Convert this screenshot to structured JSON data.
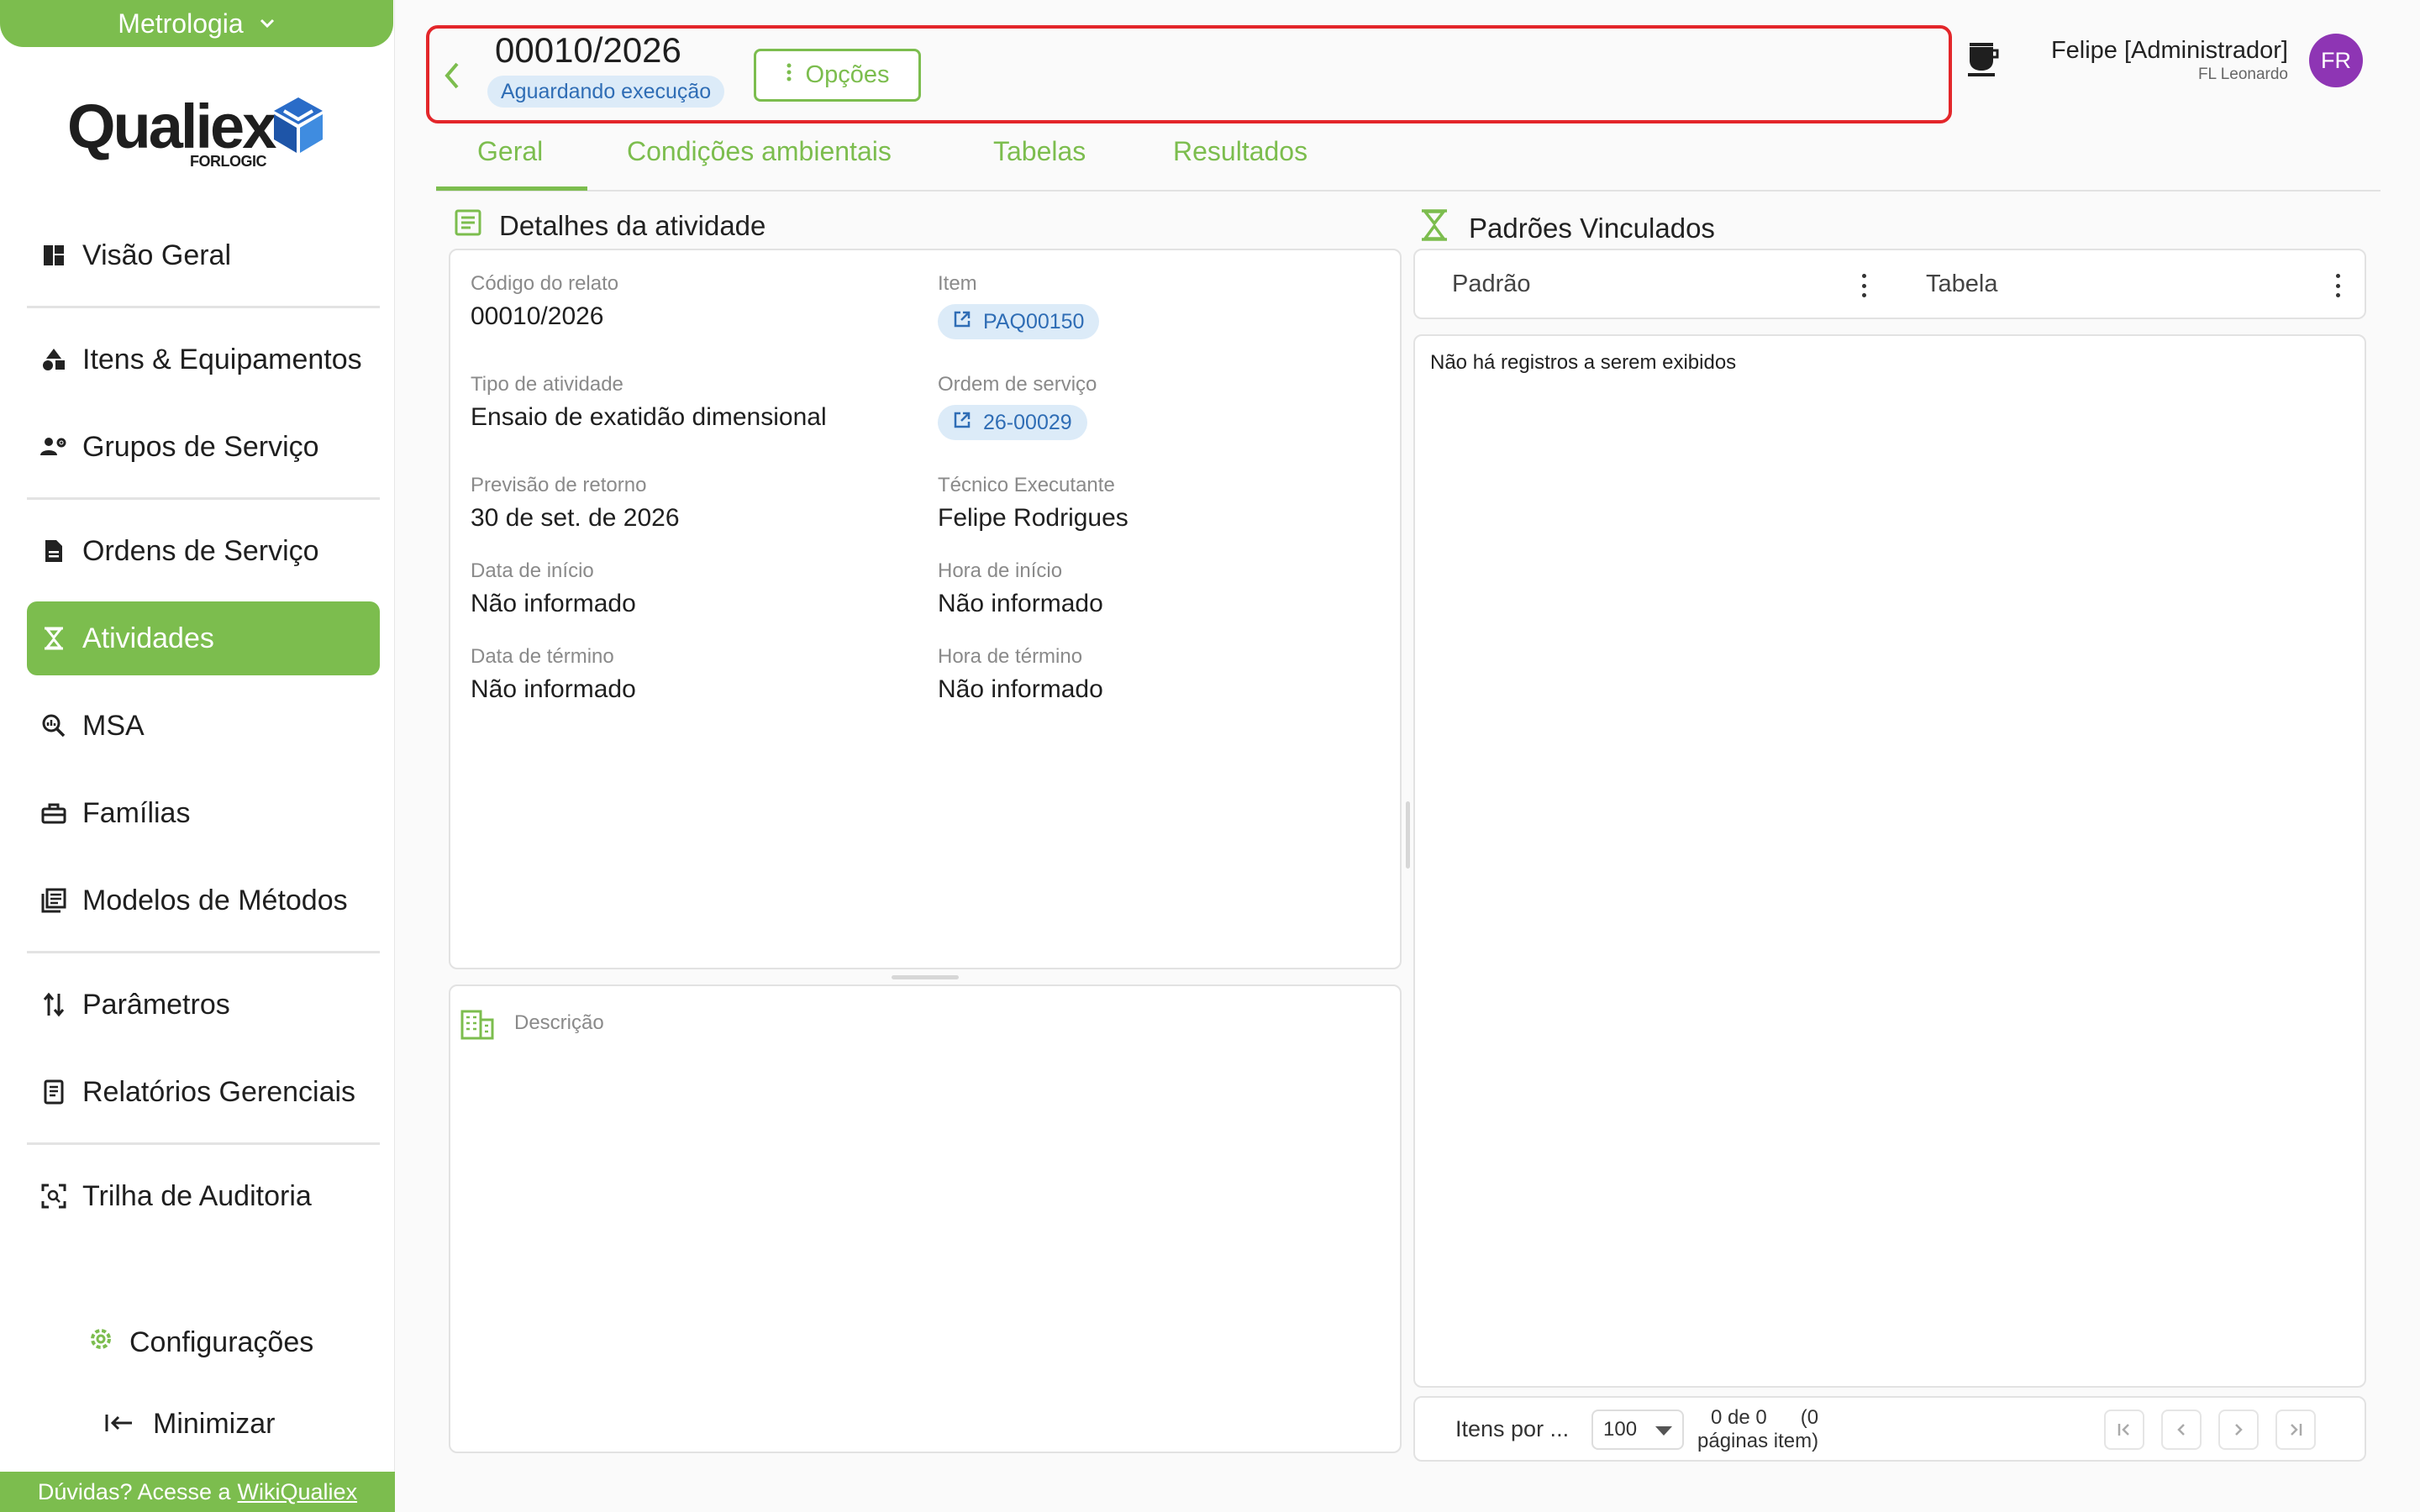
{
  "sidebar": {
    "module": "Metrologia",
    "logo": {
      "word": "Qualiex",
      "sub": "FORLOGIC"
    },
    "items": [
      {
        "label": "Visão Geral",
        "icon": "dashboard-icon"
      },
      {
        "label": "Itens & Equipamentos",
        "icon": "shapes-icon"
      },
      {
        "label": "Grupos de Serviço",
        "icon": "people-gear-icon"
      },
      {
        "label": "Ordens de Serviço",
        "icon": "document-icon"
      },
      {
        "label": "Atividades",
        "icon": "hourglass-icon",
        "active": true
      },
      {
        "label": "MSA",
        "icon": "magnifier-chart-icon"
      },
      {
        "label": "Famílias",
        "icon": "toolbox-icon"
      },
      {
        "label": "Modelos de Métodos",
        "icon": "library-icon"
      },
      {
        "label": "Parâmetros",
        "icon": "sort-arrows-icon"
      },
      {
        "label": "Relatórios Gerenciais",
        "icon": "report-icon"
      },
      {
        "label": "Trilha de Auditoria",
        "icon": "audit-scan-icon"
      }
    ],
    "config_label": "Configurações",
    "minimize_label": "Minimizar",
    "help_text": "Dúvidas? Acesse a",
    "help_link": "WikiQualiex"
  },
  "header": {
    "title": "00010/2026",
    "status": "Aguardando execução",
    "options_label": "Opções",
    "user_name": "Felipe [Administrador]",
    "user_org": "FL Leonardo",
    "avatar_initials": "FR"
  },
  "tabs": [
    {
      "label": "Geral",
      "active": true
    },
    {
      "label": "Condições ambientais"
    },
    {
      "label": "Tabelas"
    },
    {
      "label": "Resultados"
    }
  ],
  "details": {
    "title": "Detalhes da atividade",
    "codigo": {
      "label": "Código do relato",
      "value": "00010/2026"
    },
    "item": {
      "label": "Item",
      "value": "PAQ00150"
    },
    "tipo": {
      "label": "Tipo de atividade",
      "value": "Ensaio de exatidão dimensional"
    },
    "ordem": {
      "label": "Ordem de serviço",
      "value": "26-00029"
    },
    "previsao": {
      "label": "Previsão de retorno",
      "value": "30 de set. de 2026"
    },
    "tecnico": {
      "label": "Técnico Executante",
      "value": "Felipe Rodrigues"
    },
    "data_inicio": {
      "label": "Data de início",
      "value": "Não informado"
    },
    "hora_inicio": {
      "label": "Hora de início",
      "value": "Não informado"
    },
    "data_termino": {
      "label": "Data de término",
      "value": "Não informado"
    },
    "hora_termino": {
      "label": "Hora de término",
      "value": "Não informado"
    },
    "descricao_label": "Descrição"
  },
  "padroes": {
    "title": "Padrões Vinculados",
    "columns": [
      "Padrão",
      "Tabela"
    ],
    "empty_message": "Não há registros a serem exibidos",
    "pager": {
      "items_per_label": "Itens por ...",
      "page_size": "100",
      "count_line1": "0 de 0      (0",
      "count_line2": "páginas item)"
    }
  },
  "colors": {
    "brand": "#7cbd4e",
    "highlight": "#e3262a",
    "avatar": "#8e35b4",
    "chip_bg": "#dcebf8",
    "chip_text": "#2f6db5"
  }
}
